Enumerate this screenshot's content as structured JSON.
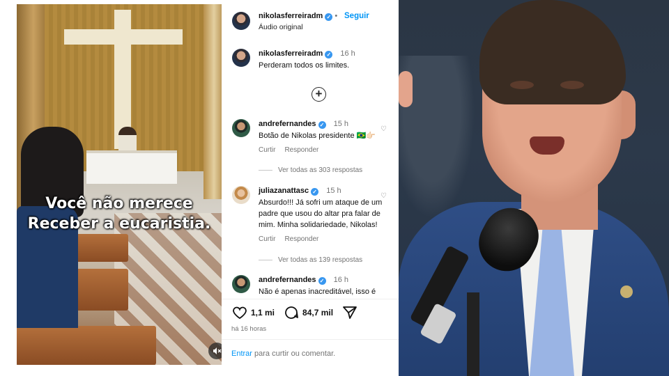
{
  "video": {
    "caption_line1": "Você não merece",
    "caption_line2": "Receber a eucaristia."
  },
  "post": {
    "author": "nikolasferreiradm",
    "follow_label": "Seguir",
    "audio": "Áudio original",
    "caption_time": "16 h",
    "caption_text": "Perderam todos os limites."
  },
  "comments": [
    {
      "user": "andrefernandes",
      "time": "15 h",
      "text": "Botão de Nikolas presidente 🇧🇷👉🏻",
      "like_label": "Curtir",
      "reply_label": "Responder",
      "view_replies": "Ver todas as 303 respostas"
    },
    {
      "user": "juliazanattasc",
      "time": "15 h",
      "text": "Absurdo!!! Já sofri um ataque de um padre que usou do altar pra falar de mim. Minha solidariedade, Nikolas!",
      "like_label": "Curtir",
      "reply_label": "Responder",
      "view_replies": "Ver todas as 139 respostas"
    },
    {
      "user": "andrefernandes",
      "time": "16 h",
      "text": "Não é apenas inacreditável, isso é"
    }
  ],
  "stats": {
    "likes": "1,1 mi",
    "comments": "84,7 mil",
    "posted": "há 16 horas"
  },
  "add_comment": {
    "login": "Entrar",
    "rest": "para curtir ou comentar."
  },
  "icons": {
    "verified": "verified-badge-icon",
    "add": "plus-circle-icon",
    "like": "heart-icon",
    "comment": "comment-bubble-icon",
    "share": "send-icon",
    "mute": "speaker-muted-icon"
  },
  "colors": {
    "link_blue": "#0095f6",
    "verified_blue": "#3897f0",
    "muted_text": "#737373"
  }
}
